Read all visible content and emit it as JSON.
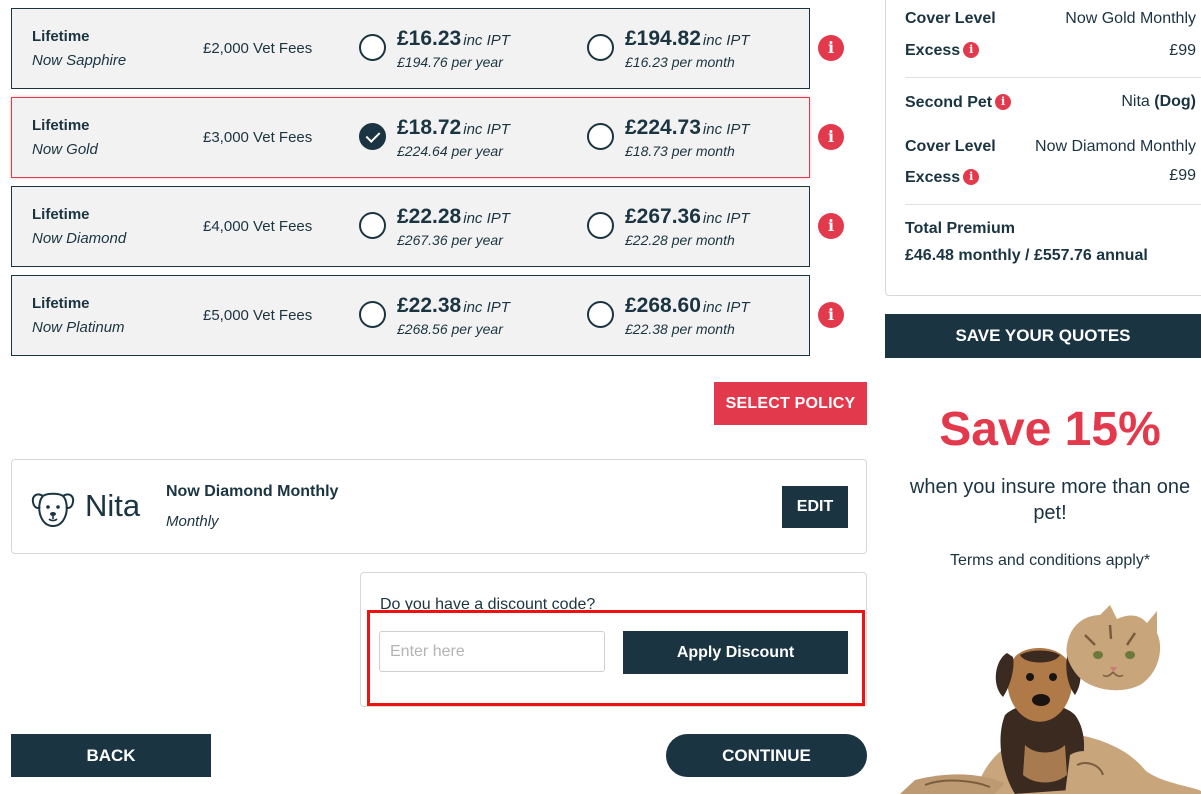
{
  "policies": [
    {
      "type": "Lifetime",
      "name": "Now Sapphire",
      "fees": "£2,000 Vet Fees",
      "annual_price": "£16.23",
      "annual_sub": "£194.76 per year",
      "monthly_price": "£194.82",
      "monthly_sub": "£16.23 per month",
      "ipt": "inc IPT",
      "selected": false
    },
    {
      "type": "Lifetime",
      "name": "Now Gold",
      "fees": "£3,000 Vet Fees",
      "annual_price": "£18.72",
      "annual_sub": "£224.64 per year",
      "monthly_price": "£224.73",
      "monthly_sub": "£18.73 per month",
      "ipt": "inc IPT",
      "selected": true
    },
    {
      "type": "Lifetime",
      "name": "Now Diamond",
      "fees": "£4,000 Vet Fees",
      "annual_price": "£22.28",
      "annual_sub": "£267.36 per year",
      "monthly_price": "£267.36",
      "monthly_sub": "£22.28 per month",
      "ipt": "inc IPT",
      "selected": false
    },
    {
      "type": "Lifetime",
      "name": "Now Platinum",
      "fees": "£5,000 Vet Fees",
      "annual_price": "£22.38",
      "annual_sub": "£268.56 per year",
      "monthly_price": "£268.60",
      "monthly_sub": "£22.38 per month",
      "ipt": "inc IPT",
      "selected": false
    }
  ],
  "info_icon_glyph": "i",
  "select_policy_label": "SELECT POLICY",
  "pet": {
    "name": "Nita",
    "plan": "Now Diamond Monthly",
    "frequency": "Monthly",
    "edit_label": "EDIT"
  },
  "discount": {
    "question": "Do you have a discount code?",
    "placeholder": "Enter here",
    "value": "",
    "apply_label": "Apply Discount"
  },
  "back_label": "BACK",
  "continue_label": "CONTINUE",
  "summary": {
    "first_cover_label": "Cover Level",
    "first_cover_value": "Now Gold Monthly",
    "first_excess_label": "Excess",
    "first_excess_value": "£99",
    "second_pet_label": "Second Pet",
    "second_pet_name": "Nita",
    "second_pet_species": "(Dog)",
    "second_cover_label": "Cover Level",
    "second_cover_value": "Now Diamond Monthly",
    "second_excess_label": "Excess",
    "second_excess_value": "£99",
    "total_label": "Total Premium",
    "total_value": "£46.48 monthly / £557.76 annual"
  },
  "save_quotes_label": "SAVE YOUR QUOTES",
  "promo": {
    "headline": "Save 15%",
    "subtext": "when you insure more than one pet!",
    "terms": "Terms and conditions apply*"
  },
  "colors": {
    "navy": "#1b3441",
    "accent_red": "#e23a4c",
    "panel_grey": "#f2f2f2",
    "highlight": "#ee1111"
  }
}
